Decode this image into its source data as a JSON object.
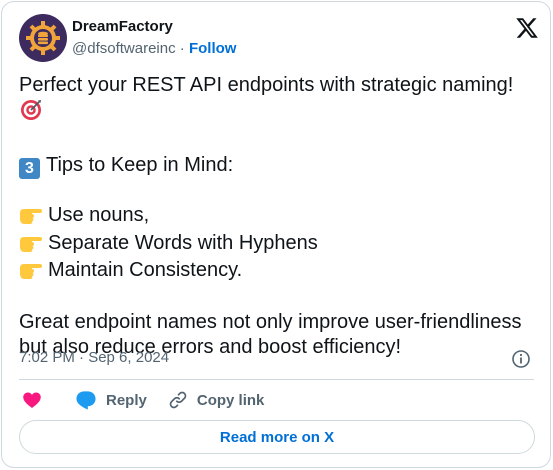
{
  "author": {
    "name": "DreamFactory",
    "handle": "@dfsoftwareinc",
    "separator": "·",
    "follow_label": "Follow"
  },
  "tweet": {
    "line1": "Perfect your REST API endpoints with strategic naming!",
    "line1_emoji": "target-icon",
    "tips_number": "3",
    "tips_heading": "Tips to Keep in Mind:",
    "tips": [
      "Use nouns,",
      "Separate Words with Hyphens",
      "Maintain Consistency."
    ],
    "closing": "Great endpoint names not only improve user-friendliness but also reduce errors and boost efficiency!"
  },
  "meta": {
    "timestamp": "7:02 PM · Sep 6, 2024"
  },
  "actions": {
    "like_icon": "heart-icon",
    "reply_label": "Reply",
    "copy_label": "Copy link"
  },
  "read_more_label": "Read more on X",
  "colors": {
    "accent": "#006fd6",
    "like": "#f91880",
    "reply": "#1d9bf0",
    "muted": "#536471",
    "border": "#cfd9de"
  }
}
